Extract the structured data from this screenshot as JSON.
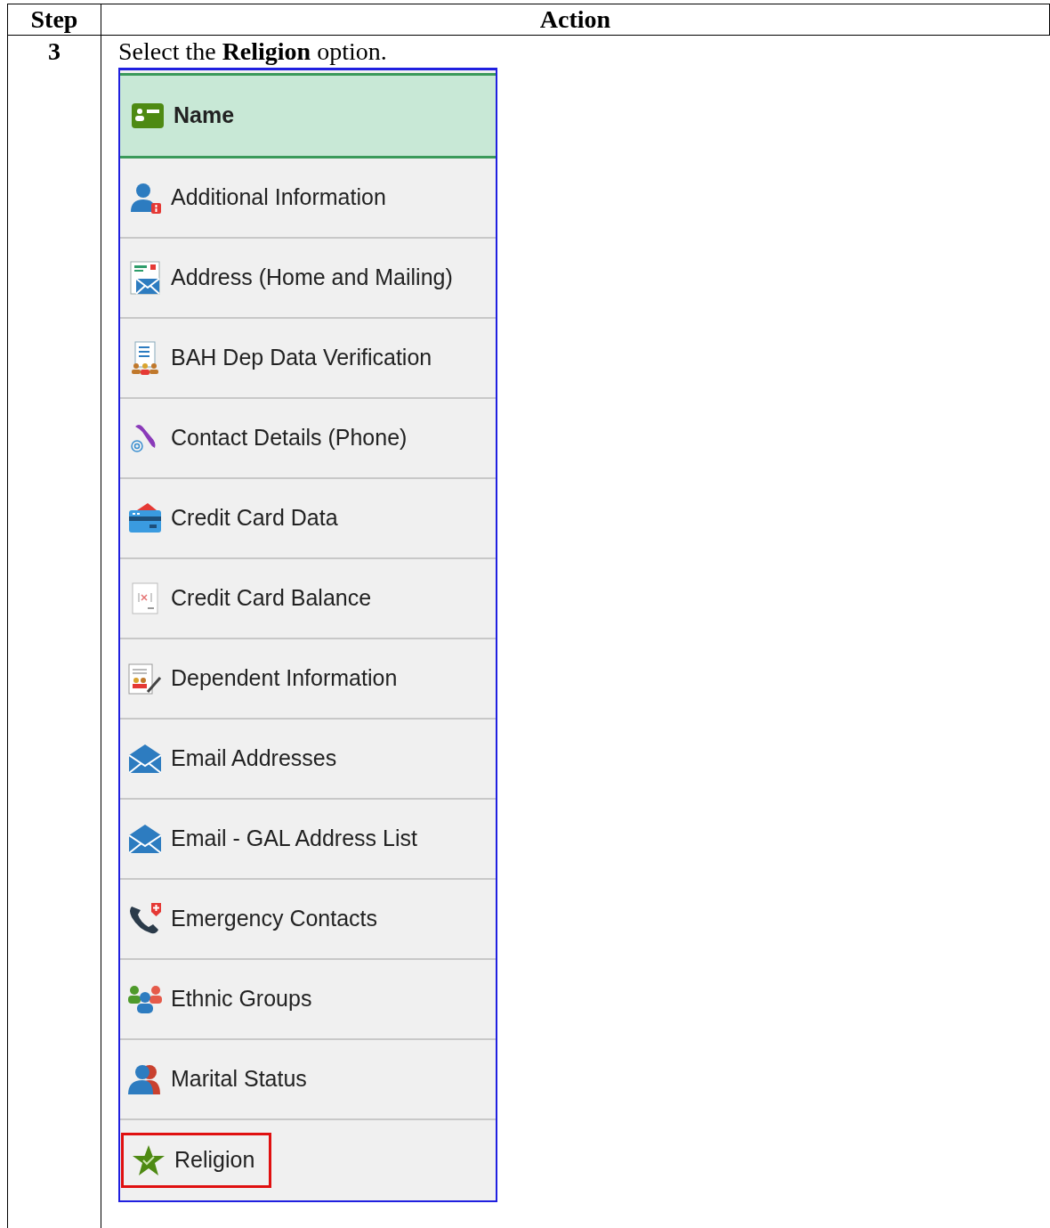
{
  "table": {
    "columns": [
      "Step",
      "Action"
    ],
    "rows": [
      {
        "step": "3",
        "instruction": "Select the **Religion** option.",
        "menu": [
          {
            "label": "Name",
            "selected": true,
            "highlighted": false
          },
          {
            "label": "Additional Information",
            "selected": false,
            "highlighted": false
          },
          {
            "label": "Address (Home and Mailing)",
            "selected": false,
            "highlighted": false
          },
          {
            "label": "BAH Dep Data Verification",
            "selected": false,
            "highlighted": false
          },
          {
            "label": "Contact Details (Phone)",
            "selected": false,
            "highlighted": false
          },
          {
            "label": "Credit Card Data",
            "selected": false,
            "highlighted": false
          },
          {
            "label": "Credit Card Balance",
            "selected": false,
            "highlighted": false
          },
          {
            "label": "Dependent Information",
            "selected": false,
            "highlighted": false
          },
          {
            "label": "Email Addresses",
            "selected": false,
            "highlighted": false
          },
          {
            "label": "Email - GAL Address List",
            "selected": false,
            "highlighted": false
          },
          {
            "label": "Emergency Contacts",
            "selected": false,
            "highlighted": false
          },
          {
            "label": "Ethnic Groups",
            "selected": false,
            "highlighted": false
          },
          {
            "label": "Marital Status",
            "selected": false,
            "highlighted": false
          },
          {
            "label": "Religion",
            "selected": false,
            "highlighted": true
          }
        ]
      }
    ]
  }
}
